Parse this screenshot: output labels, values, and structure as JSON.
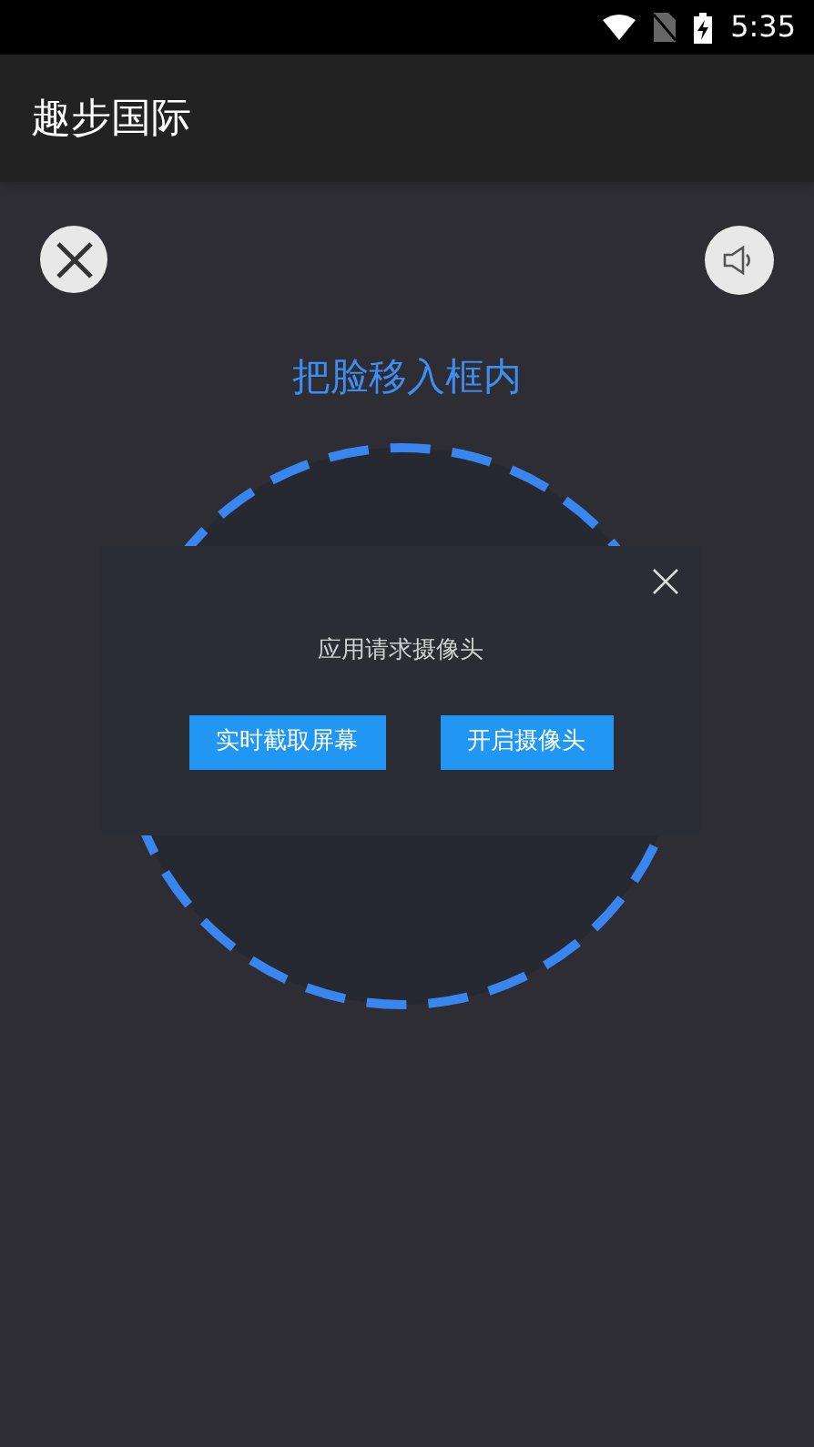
{
  "status_bar": {
    "time": "5:35"
  },
  "app_bar": {
    "title": "趣步国际"
  },
  "face_scan": {
    "instruction": "把脸移入框内"
  },
  "dialog": {
    "message": "应用请求摄像头",
    "buttons": [
      "实时截取屏幕",
      "开启摄像头"
    ]
  }
}
